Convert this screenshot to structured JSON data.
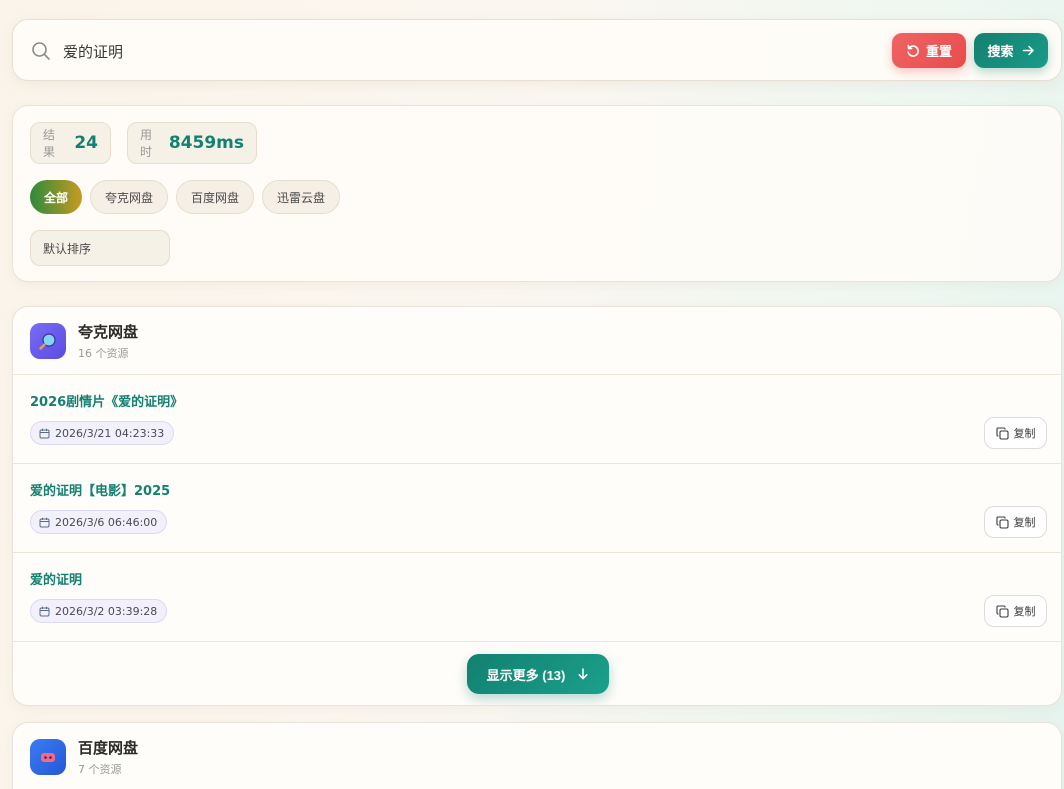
{
  "search": {
    "query": "爱的证明",
    "reset_label": "重置",
    "search_label": "搜索"
  },
  "stats": {
    "results_label": "结果",
    "results_value": "24",
    "time_label": "用时",
    "time_value": "8459ms"
  },
  "filters": [
    "全部",
    "夸克网盘",
    "百度网盘",
    "迅雷云盘"
  ],
  "sort": {
    "selected": "默认排序"
  },
  "providers": [
    {
      "name": "夸克网盘",
      "count": "16 个资源",
      "items": [
        {
          "title": "2026剧情片《爱的证明》",
          "date": "2026/3/21 04:23:33",
          "copy_label": "复制"
        },
        {
          "title": "爱的证明【电影】2025",
          "date": "2026/3/6 06:46:00",
          "copy_label": "复制"
        },
        {
          "title": "爱的证明",
          "date": "2026/3/2 03:39:28",
          "copy_label": "复制"
        }
      ],
      "more_label": "显示更多 (13)"
    },
    {
      "name": "百度网盘",
      "count": "7 个资源"
    }
  ],
  "colors": {
    "accent": "#14806f",
    "danger": "#e84c4c",
    "quark_logo": "#6b5cf0",
    "baidu_logo": "#2f6ee8"
  },
  "icons": {
    "search": "search-icon",
    "reset": "refresh-icon",
    "arrow": "arrow-right-icon",
    "calendar": "calendar-icon",
    "copy": "copy-icon",
    "more": "arrow-down-icon"
  }
}
